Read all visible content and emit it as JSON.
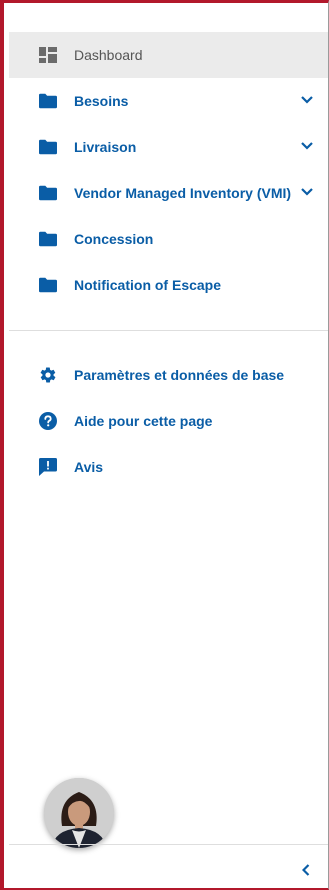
{
  "colors": {
    "accent": "#0a5da6",
    "frame_border": "#b2182b",
    "active_bg": "#ebebeb"
  },
  "sidebar": {
    "items": [
      {
        "label": "Dashboard",
        "icon": "dashboard-icon",
        "active": true
      },
      {
        "label": "Besoins",
        "icon": "folder-icon",
        "expandable": true
      },
      {
        "label": "Livraison",
        "icon": "folder-icon",
        "expandable": true
      },
      {
        "label": "Vendor Managed Inventory (VMI)",
        "icon": "folder-icon",
        "expandable": true
      },
      {
        "label": "Concession",
        "icon": "folder-icon"
      },
      {
        "label": "Notification of Escape",
        "icon": "folder-icon"
      }
    ],
    "secondary_items": [
      {
        "label": "Paramètres et données de base",
        "icon": "gear-icon"
      },
      {
        "label": "Aide pour cette page",
        "icon": "help-icon"
      },
      {
        "label": "Avis",
        "icon": "feedback-icon"
      }
    ],
    "user_avatar": "avatar-photo",
    "collapse_icon": "chevron-left-icon"
  }
}
